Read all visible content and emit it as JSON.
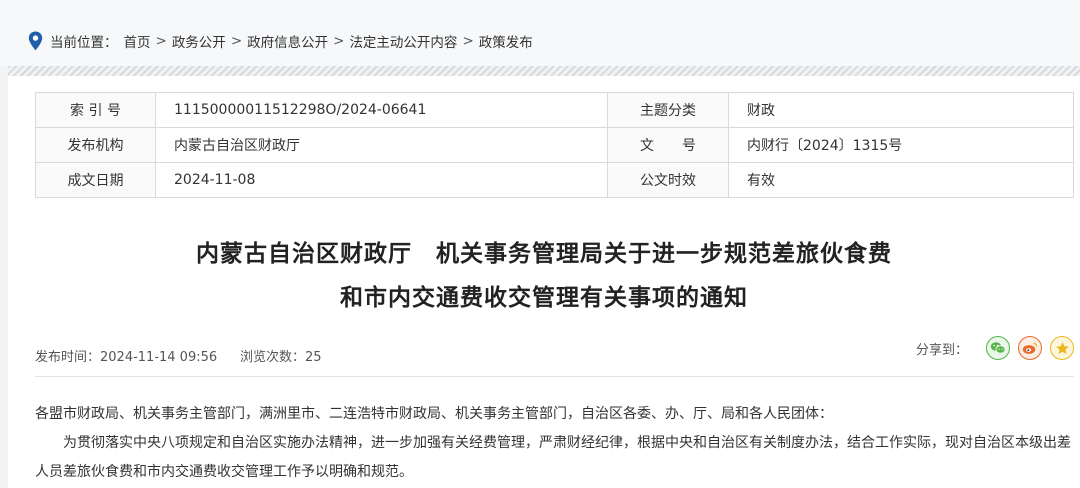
{
  "breadcrumb": {
    "label": "当前位置：",
    "items": [
      "首页",
      "政务公开",
      "政府信息公开",
      "法定主动公开内容",
      "政策发布"
    ],
    "separator": ">"
  },
  "meta": {
    "index_label": "索 引 号",
    "index_value": "11150000011512298O/2024-06641",
    "topic_label": "主题分类",
    "topic_value": "财政",
    "publisher_label": "发布机构",
    "publisher_value": "内蒙古自治区财政厅",
    "docno_label": "文　　号",
    "docno_value": "内财行〔2024〕1315号",
    "date_label": "成文日期",
    "date_value": "2024-11-08",
    "validity_label": "公文时效",
    "validity_value": "有效"
  },
  "title": {
    "line1": "内蒙古自治区财政厅　机关事务管理局关于进一步规范差旅伙食费",
    "line2": "和市内交通费收交管理有关事项的通知"
  },
  "info": {
    "publish_time": "发布时间：2024-11-14 09:56",
    "views": "浏览次数：25",
    "share_label": "分享到："
  },
  "icons": {
    "location": "location-pin-icon",
    "wechat": "wechat-icon",
    "weibo": "weibo-icon",
    "favorite": "star-icon"
  },
  "colors": {
    "pin": "#1f5fa8",
    "wechat": "#56b34a",
    "weibo": "#e66a2c",
    "favorite": "#e9b81d"
  },
  "content": {
    "p1": "各盟市财政局、机关事务主管部门，满洲里市、二连浩特市财政局、机关事务主管部门，自治区各委、办、厅、局和各人民团体：",
    "p2": "为贯彻落实中央八项规定和自治区实施办法精神，进一步加强有关经费管理，严肃财经纪律，根据中央和自治区有关制度办法，结合工作实际，现对自治区本级出差人员差旅伙食费和市内交通费收交管理工作予以明确和规范。"
  }
}
